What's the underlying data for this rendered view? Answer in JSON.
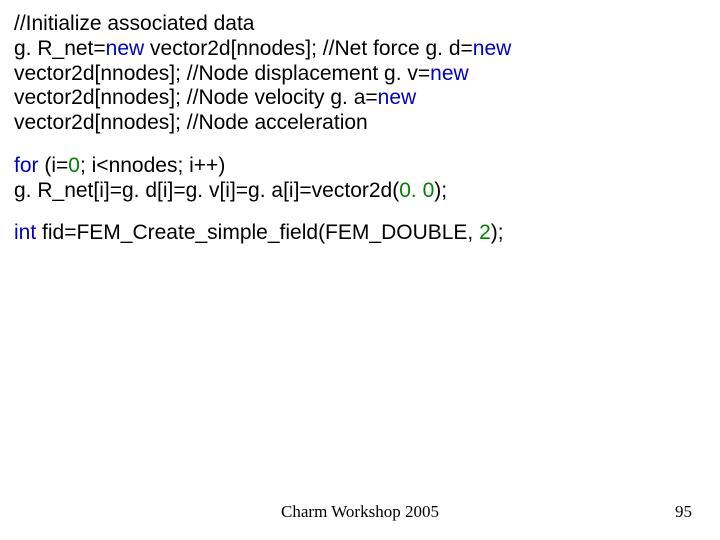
{
  "code": {
    "comment1": "//Initialize associated data",
    "l1": "g. R_net=",
    "l1_kw": "new",
    "l1b": " vector2d[nnodes]; //Net force  g. d=",
    "l1_kw2": "new",
    "l2": "vector2d[nnodes]; //Node displacement  g. v=",
    "l2_kw": "new",
    "l3": "vector2d[nnodes]; //Node velocity  g. a=",
    "l3_kw": "new",
    "l4": "vector2d[nnodes]; //Node acceleration",
    "l5_kw": "for",
    "l5": " (i=",
    "l5_n0": "0",
    "l5b": "; i<nnodes; i++)",
    "l6": "g. R_net[i]=g. d[i]=g. v[i]=g. a[i]=vector2d(",
    "l6_n0": "0. 0",
    "l6b": ");",
    "l7_kw": "int",
    "l7": " fid=FEM_Create_simple_field(FEM_DOUBLE, ",
    "l7_n0": "2",
    "l7b": ");"
  },
  "footer": "Charm Workshop 2005",
  "page": "95"
}
